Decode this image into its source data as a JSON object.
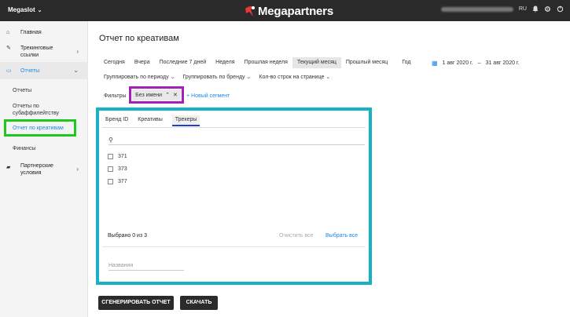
{
  "topbar": {
    "brand": "Megaslot",
    "logo_text": "Megapartners",
    "lang": "RU"
  },
  "sidebar": {
    "items": [
      {
        "label": "Главная",
        "icon": "home-icon"
      },
      {
        "label": "Трекинговые ссылки",
        "icon": "link-icon"
      },
      {
        "label": "Отчеты",
        "icon": "reports-icon"
      },
      {
        "label": "Партнерские условия",
        "icon": "briefcase-icon"
      }
    ],
    "subitems": [
      {
        "label": "Отчеты"
      },
      {
        "label": "Отчеты по субаффилейтству"
      },
      {
        "label": "Отчет по креативам"
      },
      {
        "label": "Финансы"
      }
    ]
  },
  "main": {
    "title": "Отчет по креативам",
    "periods": [
      "Сегодня",
      "Вчера",
      "Последние 7 дней",
      "Неделя",
      "Прошлая неделя",
      "Текущий месяц",
      "Прошлый месяц",
      "Год"
    ],
    "active_period": "Текущий месяц",
    "date_from": "1 авг 2020 г.",
    "date_sep": "–",
    "date_to": "31 авг 2020 г.",
    "group_by_period": "Группировать по периоду",
    "group_by_brand": "Группировать по бренду",
    "rows_per_page": "Кол-во строк на странице",
    "filters_label": "Фильтры",
    "segment_chip": "Без имени",
    "new_segment": "+ Новый сегмент"
  },
  "panel": {
    "tabs": [
      "Бренд ID",
      "Креативы",
      "Трекеры"
    ],
    "active_tab": "Трекеры",
    "options": [
      "371",
      "373",
      "377"
    ],
    "selected_count": "Выбрано 0 из 3",
    "clear_all": "Очистить все",
    "select_all": "Выбрать все",
    "names_placeholder": "Названия"
  },
  "actions": {
    "generate": "СГЕНЕРИРОВАТЬ ОТЧЕТ",
    "download": "СКАЧАТЬ"
  },
  "colors": {
    "topbar": "#2a2a2a",
    "accent": "#1e88e5",
    "panel_highlight": "#17b3c4",
    "chip_highlight": "#a51fb8",
    "sidebar_highlight": "#1fc71f",
    "logo_red": "#e53935"
  }
}
